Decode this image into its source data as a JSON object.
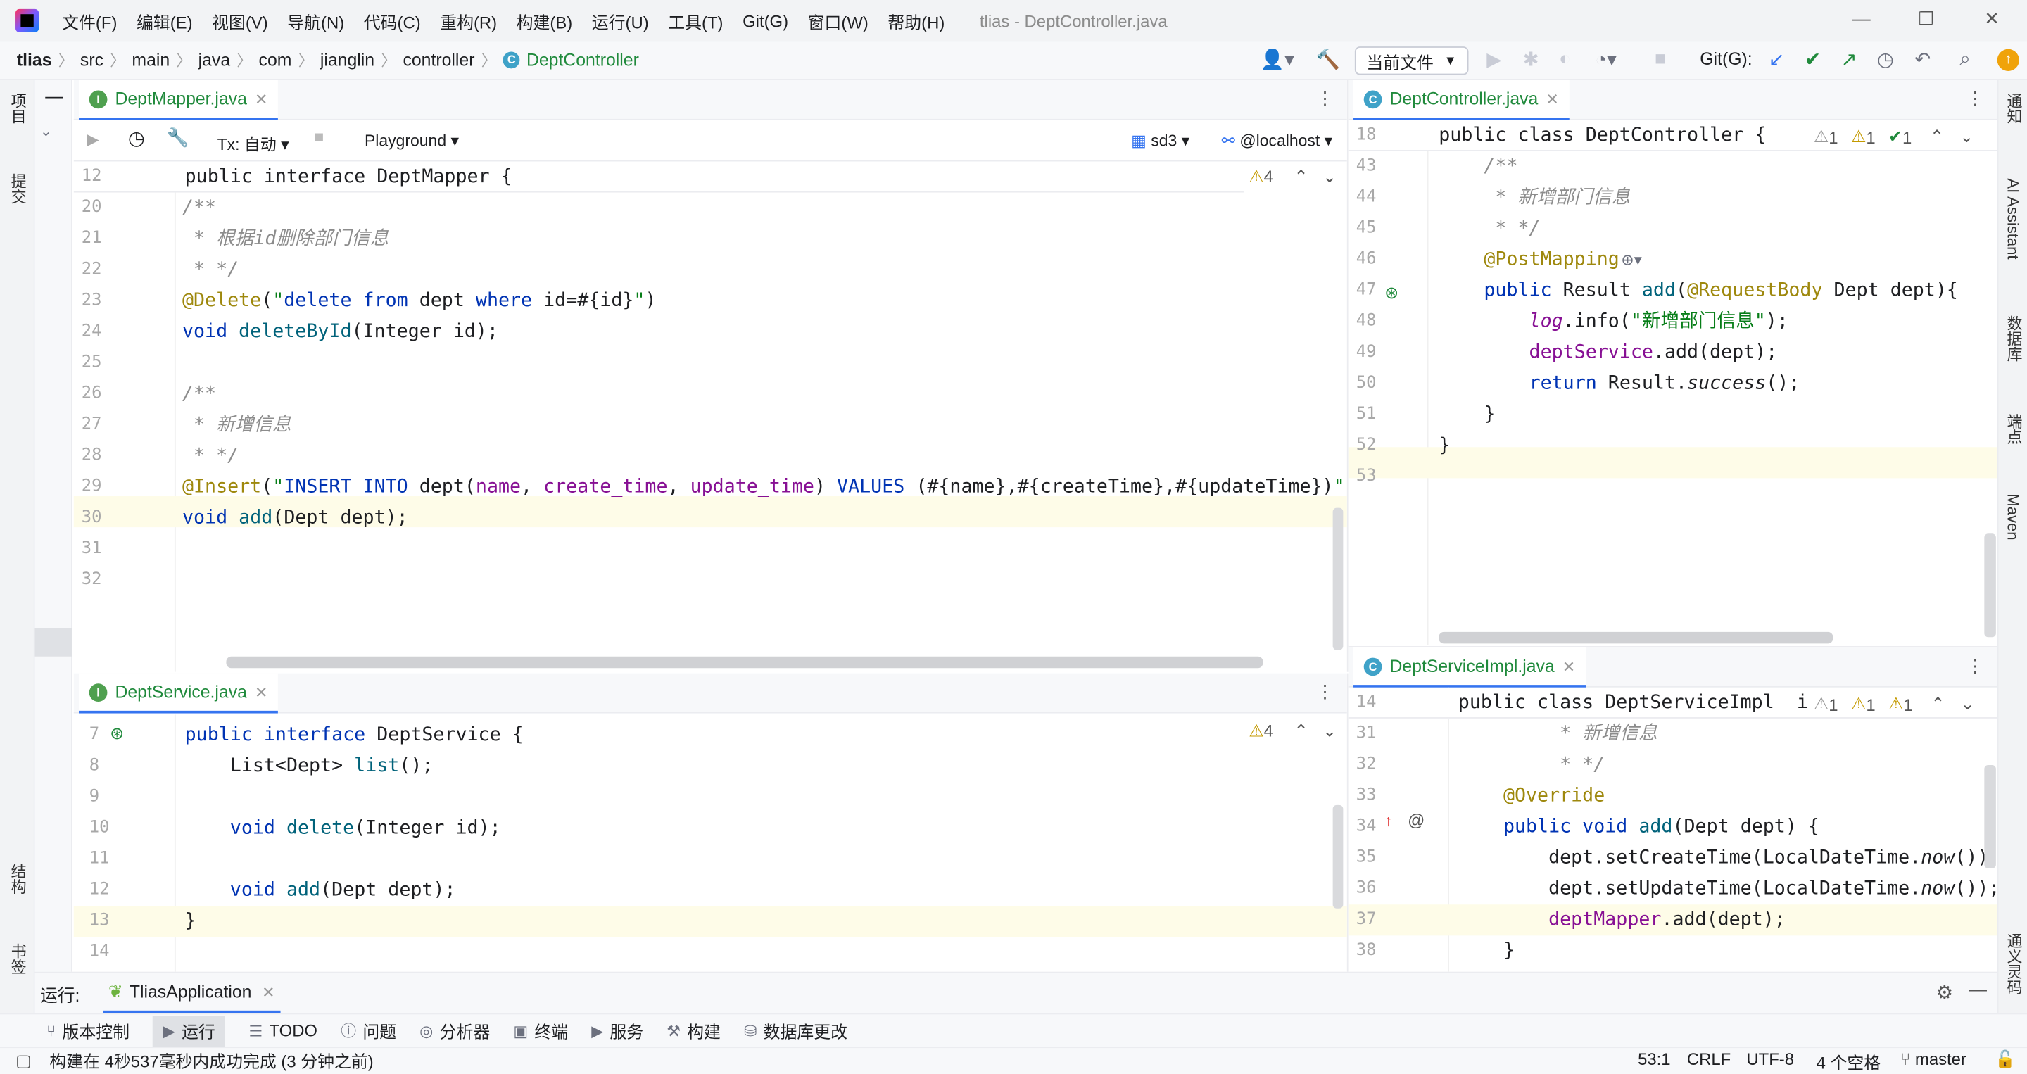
{
  "app": {
    "window_title": "tlias - DeptController.java"
  },
  "menu": [
    "文件(F)",
    "编辑(E)",
    "视图(V)",
    "导航(N)",
    "代码(C)",
    "重构(R)",
    "构建(B)",
    "运行(U)",
    "工具(T)",
    "Git(G)",
    "窗口(W)",
    "帮助(H)"
  ],
  "breadcrumb": [
    "tlias",
    "src",
    "main",
    "java",
    "com",
    "jianglin",
    "controller",
    "DeptController"
  ],
  "toolbar": {
    "run_config": "当前文件",
    "git_label": "Git(G):"
  },
  "left_strip": {
    "project": "项目",
    "commit": "提交",
    "structure": "结构",
    "bookmarks": "书签"
  },
  "right_strip": {
    "notifications": "通知",
    "ai": "AI Assistant",
    "database": "数据库",
    "endpoints": "端点",
    "maven": "Maven",
    "copilot": "通义灵码"
  },
  "db_toolbar": {
    "tx": "Tx: 自动",
    "playground": "Playground",
    "schema": "sd3",
    "host": "@localhost"
  },
  "panels": {
    "mapper": {
      "tab": "DeptMapper.java",
      "warnings": "4",
      "sticky_no": "12",
      "sticky": "public interface DeptMapper {",
      "lines": [
        {
          "no": "20",
          "html": "<span class='cm'>/**</span>"
        },
        {
          "no": "21",
          "html": "<span class='cm'> * 根据id删除部门信息</span>"
        },
        {
          "no": "22",
          "html": "<span class='cm'> * */</span>"
        },
        {
          "no": "23",
          "html": "<span class='an'>@Delete</span>(<span class='st'>\"</span><span class='kw'>delete from</span> dept <span class='kw'>where</span> id=#{id}<span class='st'>\"</span>)"
        },
        {
          "no": "24",
          "html": "<span class='kw'>void</span> <span class='fn'>deleteById</span>(Integer id);"
        },
        {
          "no": "25",
          "html": ""
        },
        {
          "no": "26",
          "html": "<span class='cm'>/**</span>"
        },
        {
          "no": "27",
          "html": "<span class='cm'> * 新增信息</span>"
        },
        {
          "no": "28",
          "html": "<span class='cm'> * */</span>"
        },
        {
          "no": "29",
          "html": "<span class='an'>@Insert</span>(<span class='st'>\"</span><span class='kw'>INSERT INTO</span> dept(<span class='fd'>name</span>, <span class='fd'>create_time</span>, <span class='fd'>update_time</span>) <span class='kw'>VALUES</span> (#{name},#{createTime},#{updateTime})<span class='st'>\"</span>)"
        },
        {
          "no": "30",
          "html": "<span class='kw'>void</span> <span class='fn'>add</span>(Dept dept);"
        },
        {
          "no": "31",
          "html": ""
        },
        {
          "no": "32",
          "html": ""
        }
      ]
    },
    "service": {
      "tab": "DeptService.java",
      "warnings": "4",
      "lines": [
        {
          "no": "7",
          "html": "<span class='kw'>public interface</span> DeptService {"
        },
        {
          "no": "8",
          "html": "    List&lt;Dept&gt; <span class='fn'>list</span>();"
        },
        {
          "no": "9",
          "html": ""
        },
        {
          "no": "10",
          "html": "    <span class='kw'>void</span> <span class='fn'>delete</span>(Integer id);"
        },
        {
          "no": "11",
          "html": ""
        },
        {
          "no": "12",
          "html": "    <span class='kw'>void</span> <span class='fn'>add</span>(Dept dept);"
        },
        {
          "no": "13",
          "html": "}"
        },
        {
          "no": "14",
          "html": ""
        }
      ]
    },
    "controller": {
      "tab": "DeptController.java",
      "w1": "1",
      "w2": "1",
      "w3": "1",
      "sticky_no": "18",
      "sticky": "public class DeptController {",
      "lines": [
        {
          "no": "43",
          "html": "    <span class='cm'>/**</span>"
        },
        {
          "no": "44",
          "html": "<span class='cm'>     * 新增部门信息</span>"
        },
        {
          "no": "45",
          "html": "<span class='cm'>     * */</span>"
        },
        {
          "no": "46",
          "html": "    <span class='an'>@PostMapping</span>"
        },
        {
          "no": "47",
          "html": "    <span class='kw'>public</span> Result <span class='fn'>add</span>(<span class='an'>@RequestBody</span> Dept dept){"
        },
        {
          "no": "48",
          "html": "        <span class='fd it'>log</span>.info(<span class='st'>\"新增部门信息\"</span>);"
        },
        {
          "no": "49",
          "html": "        <span class='fd'>deptService</span>.add(dept);"
        },
        {
          "no": "50",
          "html": "        <span class='kw'>return</span> Result.<span class='it'>success</span>();"
        },
        {
          "no": "51",
          "html": "    }"
        },
        {
          "no": "52",
          "html": "}"
        },
        {
          "no": "53",
          "html": ""
        }
      ]
    },
    "impl": {
      "tab": "DeptServiceImpl.java",
      "w1": "1",
      "w2": "1",
      "w3": "1",
      "sticky_no": "14",
      "sticky": "public class DeptServiceImpl  i",
      "lines": [
        {
          "no": "31",
          "html": "<span class='cm'>         * 新增信息</span>"
        },
        {
          "no": "32",
          "html": "<span class='cm'>         * */</span>"
        },
        {
          "no": "33",
          "html": "    <span class='an'>@Override</span>"
        },
        {
          "no": "34",
          "html": "    <span class='kw'>public void</span> <span class='fn'>add</span>(Dept dept) {"
        },
        {
          "no": "35",
          "html": "        dept.setCreateTime(LocalDateTime.<span class='it'>now</span>());"
        },
        {
          "no": "36",
          "html": "        dept.setUpdateTime(LocalDateTime.<span class='it'>now</span>());"
        },
        {
          "no": "37",
          "html": "        <span class='fd'>deptMapper</span>.add(dept);"
        },
        {
          "no": "38",
          "html": "    }"
        }
      ]
    }
  },
  "run": {
    "label": "运行:",
    "app": "TliasApplication"
  },
  "tool_windows": [
    "版本控制",
    "运行",
    "TODO",
    "问题",
    "分析器",
    "终端",
    "服务",
    "构建",
    "数据库更改"
  ],
  "status": {
    "message": "构建在 4秒537毫秒内成功完成 (3 分钟之前)",
    "position": "53:1",
    "line_sep": "CRLF",
    "encoding": "UTF-8",
    "indent": "4 个空格",
    "branch": "master"
  }
}
